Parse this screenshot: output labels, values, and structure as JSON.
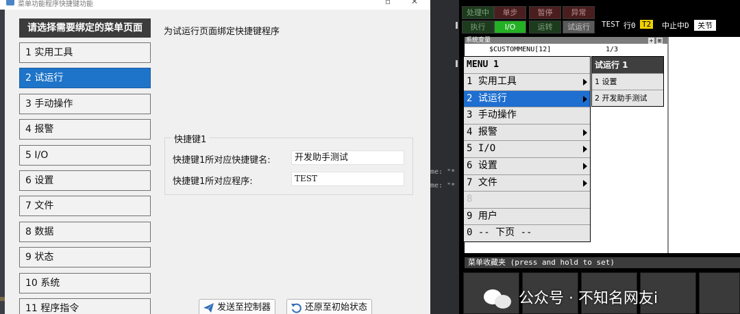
{
  "dialog": {
    "title": "菜单功能程序快捷键功能",
    "menu_header": "请选择需要绑定的菜单页面",
    "menu_items": [
      {
        "label": "1 实用工具",
        "selected": false
      },
      {
        "label": "2 试运行",
        "selected": true
      },
      {
        "label": "3 手动操作",
        "selected": false
      },
      {
        "label": "4 报警",
        "selected": false
      },
      {
        "label": "5 I/O",
        "selected": false
      },
      {
        "label": "6 设置",
        "selected": false
      },
      {
        "label": "7 文件",
        "selected": false
      },
      {
        "label": "8 数据",
        "selected": false
      },
      {
        "label": "9 状态",
        "selected": false
      },
      {
        "label": "10 系统",
        "selected": false
      },
      {
        "label": "11 程序指令",
        "selected": false
      }
    ],
    "page_title": "为试运行页面绑定快捷键程序",
    "group_title": "快捷键1",
    "field_name_label": "快捷键1所对应快捷键名:",
    "field_name_value": "开发助手测试",
    "field_prog_label": "快捷键1所对应程序:",
    "field_prog_value": "TEST",
    "send_button": "发送至控制器",
    "restore_button": "还原至初始状态"
  },
  "code_strip": {
    "line1": "me: \"*",
    "line2": "me: \"*"
  },
  "pendant": {
    "status_row1": [
      "处理中",
      "单步",
      "暂停",
      "异常"
    ],
    "status_row2": [
      "执行",
      "I/O",
      "运转",
      "试运行"
    ],
    "program": "TEST",
    "line_label": "行0",
    "mode": "T2",
    "state": "中止中D",
    "joint": "关节",
    "top_bar": "系统变量",
    "sys_var": "$CUSTOMMENU[12]",
    "page_count": "1/3",
    "menu_header": "MENU  1",
    "menu_items": [
      {
        "label": "1 实用工具",
        "arrow": true,
        "selected": false,
        "dim": false
      },
      {
        "label": "2 试运行",
        "arrow": true,
        "selected": true,
        "dim": false
      },
      {
        "label": "3 手动操作",
        "arrow": false,
        "selected": false,
        "dim": false
      },
      {
        "label": "4 报警",
        "arrow": true,
        "selected": false,
        "dim": false
      },
      {
        "label": "5 I/O",
        "arrow": true,
        "selected": false,
        "dim": false
      },
      {
        "label": "6 设置",
        "arrow": true,
        "selected": false,
        "dim": false
      },
      {
        "label": "7 文件",
        "arrow": true,
        "selected": false,
        "dim": false
      },
      {
        "label": "8",
        "arrow": false,
        "selected": false,
        "dim": true
      },
      {
        "label": "9 用户",
        "arrow": false,
        "selected": false,
        "dim": false
      },
      {
        "label": "0 -- 下页 --",
        "arrow": false,
        "selected": false,
        "dim": false
      }
    ],
    "submenu_header": "试运行  1",
    "submenu_items": [
      "1 设置",
      "2 开发助手测试"
    ],
    "favorites_bar": "菜单收藏夹 (press and hold to set)"
  },
  "watermark": "公众号 · 不知名网友i"
}
